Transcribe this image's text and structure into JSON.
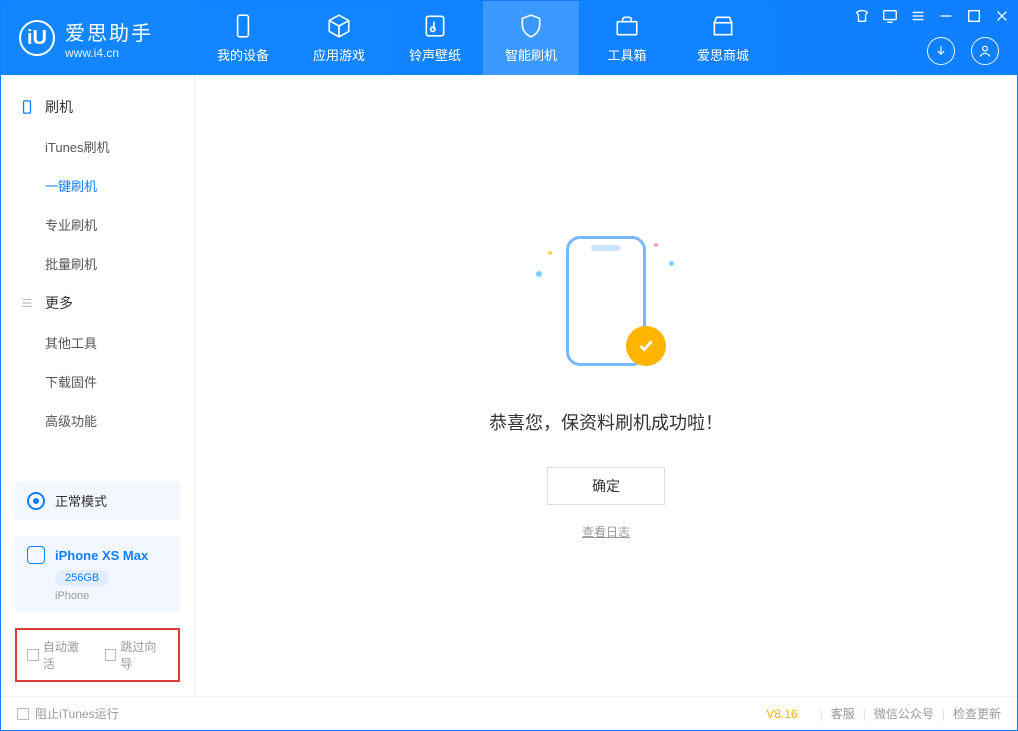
{
  "app": {
    "name_cn": "爱思助手",
    "name_en": "www.i4.cn"
  },
  "tabs": [
    {
      "label": "我的设备"
    },
    {
      "label": "应用游戏"
    },
    {
      "label": "铃声壁纸"
    },
    {
      "label": "智能刷机"
    },
    {
      "label": "工具箱"
    },
    {
      "label": "爱思商城"
    }
  ],
  "sidebar": {
    "group_flash": "刷机",
    "items_flash": [
      {
        "label": "iTunes刷机"
      },
      {
        "label": "一键刷机"
      },
      {
        "label": "专业刷机"
      },
      {
        "label": "批量刷机"
      }
    ],
    "group_more": "更多",
    "items_more": [
      {
        "label": "其他工具"
      },
      {
        "label": "下载固件"
      },
      {
        "label": "高级功能"
      }
    ]
  },
  "mode": {
    "label": "正常模式"
  },
  "device": {
    "name": "iPhone XS Max",
    "capacity": "256GB",
    "type": "iPhone"
  },
  "options": {
    "auto_activate": "自动激活",
    "skip_guide": "跳过向导"
  },
  "main": {
    "success": "恭喜您，保资料刷机成功啦！",
    "ok": "确定",
    "view_log": "查看日志"
  },
  "status": {
    "block_itunes": "阻止iTunes运行",
    "version": "V8.16",
    "links": [
      "客服",
      "微信公众号",
      "检查更新"
    ]
  }
}
